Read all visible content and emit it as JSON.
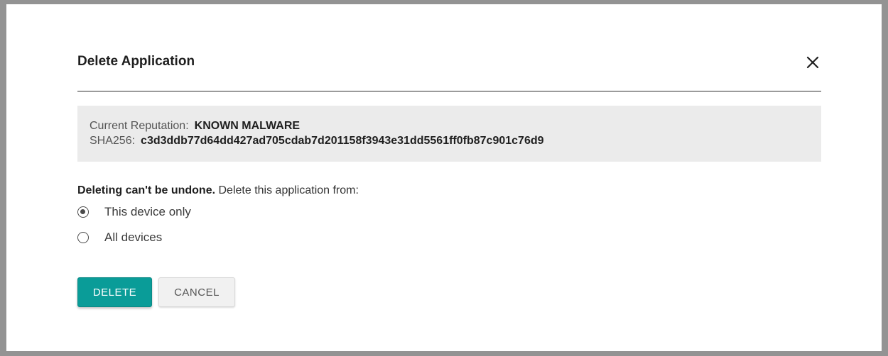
{
  "dialog": {
    "title": "Delete Application",
    "close_icon": "close-icon"
  },
  "info": {
    "reputation_label": "Current Reputation:",
    "reputation_value": "KNOWN MALWARE",
    "hash_label": "SHA256:",
    "hash_value": "c3d3ddb77d64dd427ad705cdab7d201158f3943e31dd5561ff0fb87c901c76d9"
  },
  "warning": {
    "bold_text": "Deleting can't be undone.",
    "text": "Delete this application from:"
  },
  "options": [
    {
      "label": "This device only",
      "checked": true
    },
    {
      "label": "All devices",
      "checked": false
    }
  ],
  "buttons": {
    "delete_label": "DELETE",
    "cancel_label": "CANCEL"
  },
  "colors": {
    "primary": "#0a9c98",
    "info_background": "#ebebeb",
    "overlay": "#939393"
  }
}
